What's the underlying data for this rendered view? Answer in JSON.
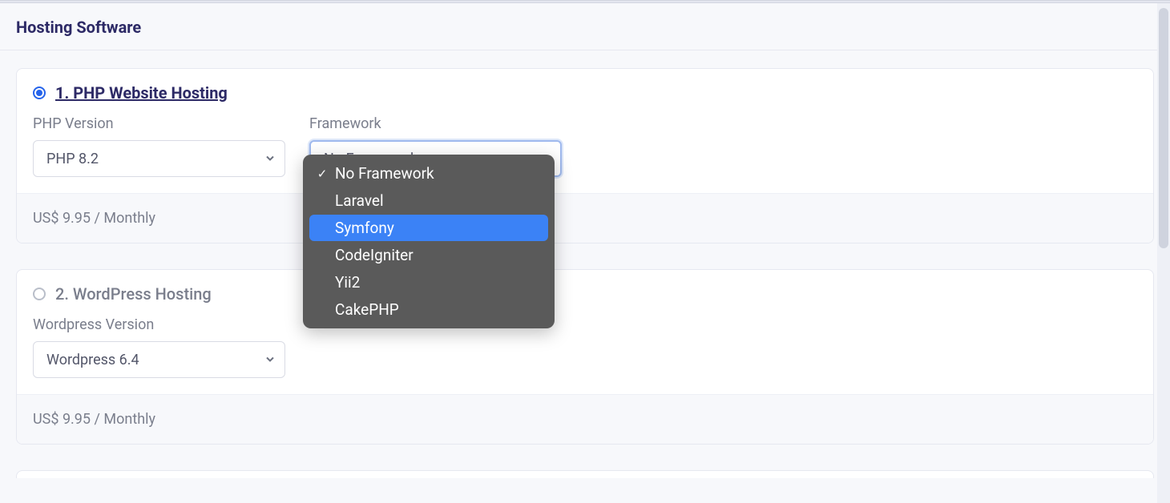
{
  "section": {
    "title": "Hosting Software"
  },
  "options": [
    {
      "title": "1. PHP Website Hosting",
      "selected": true,
      "fields": {
        "phpVersion": {
          "label": "PHP Version",
          "value": "PHP 8.2"
        },
        "framework": {
          "label": "Framework",
          "value": "No Framework"
        }
      },
      "price": "US$ 9.95 / Monthly"
    },
    {
      "title": "2. WordPress Hosting",
      "selected": false,
      "fields": {
        "wpVersion": {
          "label": "Wordpress Version",
          "value": "Wordpress 6.4"
        }
      },
      "price": "US$ 9.95 / Monthly"
    }
  ],
  "frameworkDropdown": {
    "items": [
      {
        "label": "No Framework",
        "checked": true,
        "highlight": false
      },
      {
        "label": "Laravel",
        "checked": false,
        "highlight": false
      },
      {
        "label": "Symfony",
        "checked": false,
        "highlight": true
      },
      {
        "label": "CodeIgniter",
        "checked": false,
        "highlight": false
      },
      {
        "label": "Yii2",
        "checked": false,
        "highlight": false
      },
      {
        "label": "CakePHP",
        "checked": false,
        "highlight": false
      }
    ]
  }
}
